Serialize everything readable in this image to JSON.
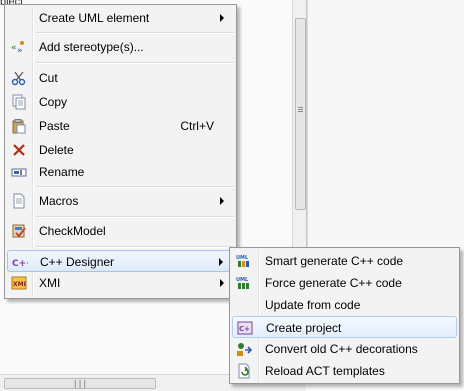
{
  "background": {
    "tab_fragment": "bject"
  },
  "context_menu": {
    "items": [
      {
        "label": "Create UML element",
        "submenu": true
      },
      {
        "label": "Add stereotype(s)..."
      },
      {
        "label": "Cut"
      },
      {
        "label": "Copy"
      },
      {
        "label": "Paste",
        "shortcut": "Ctrl+V"
      },
      {
        "label": "Delete"
      },
      {
        "label": "Rename"
      },
      {
        "label": "Macros",
        "submenu": true
      },
      {
        "label": "CheckModel"
      },
      {
        "label": "C++ Designer",
        "submenu": true
      },
      {
        "label": "XMI",
        "submenu": true
      }
    ]
  },
  "submenu": {
    "parent": "C++ Designer",
    "items": [
      {
        "label": "Smart generate C++ code"
      },
      {
        "label": "Force generate C++ code"
      },
      {
        "label": "Update from code"
      },
      {
        "label": "Create project"
      },
      {
        "label": "Convert old C++ decorations"
      },
      {
        "label": "Reload ACT templates"
      }
    ]
  },
  "colors": {
    "menu_bg": "#f3f3f3",
    "highlight_border": "#a9c4e8",
    "delete_x": "#c0392b",
    "cpp_purple": "#7b3fa0"
  }
}
